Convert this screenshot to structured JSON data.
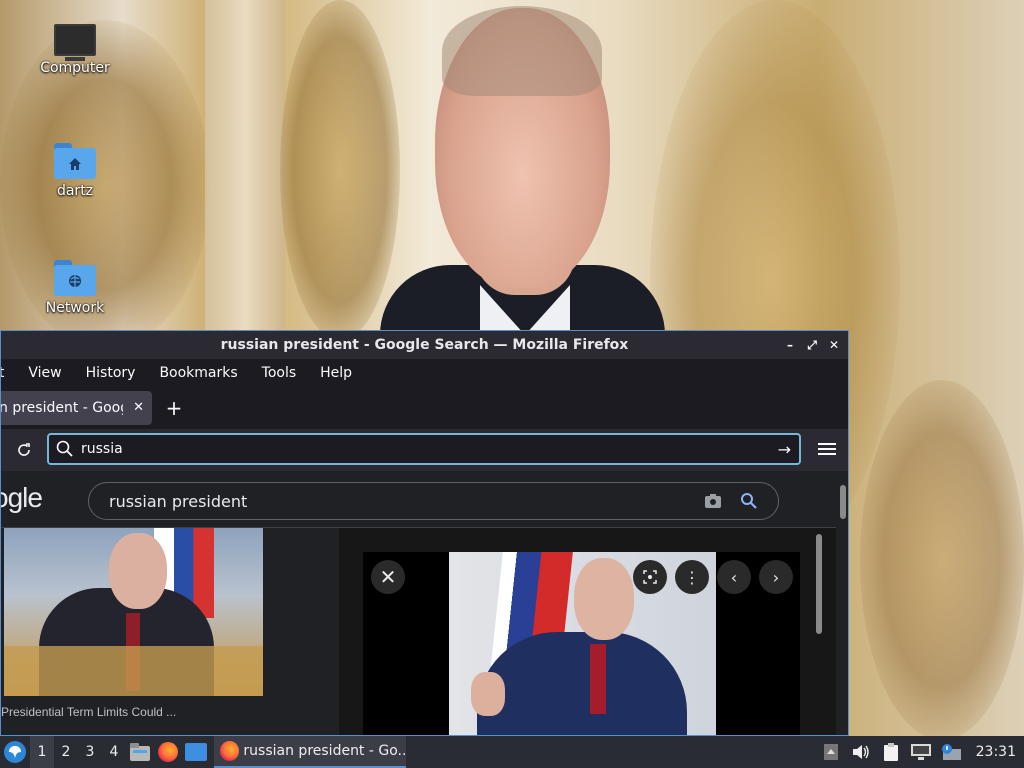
{
  "desktop": {
    "icons": [
      {
        "label": "Computer",
        "icon": "monitor-icon"
      },
      {
        "label": "dartz",
        "icon": "home-folder-icon"
      },
      {
        "label": "Network",
        "icon": "network-folder-icon"
      }
    ]
  },
  "window": {
    "title": "russian president - Google Search — Mozilla Firefox",
    "controls": {
      "minimize": "–",
      "maximize": "⤢",
      "close": "✕"
    }
  },
  "menubar": {
    "items": [
      "it",
      "View",
      "History",
      "Bookmarks",
      "Tools",
      "Help"
    ]
  },
  "tabs": {
    "active_label": "n president - Googl",
    "close_glyph": "✕",
    "new_tab_glyph": "+"
  },
  "navbar": {
    "url_value": "russia"
  },
  "page": {
    "logo_text": "ogle",
    "search_query": "russian president",
    "result_caption": "Presidential Term Limits Could ..."
  },
  "taskbar": {
    "workspaces": [
      "1",
      "2",
      "3",
      "4"
    ],
    "active_workspace": "1",
    "task_label": "russian president - Go...",
    "clock": "23:31"
  },
  "colors": {
    "accent": "#5b8fcb",
    "url_focus": "#74b7d7",
    "panel_bg": "#2a2c33"
  }
}
